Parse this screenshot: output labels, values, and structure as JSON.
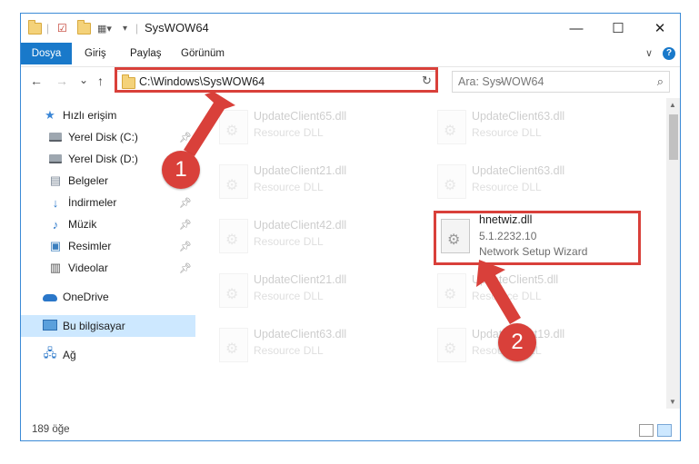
{
  "window": {
    "title": "SysWOW64",
    "controls": {
      "minimize": "—",
      "maximize": "☐",
      "close": "✕"
    }
  },
  "ribbon": {
    "tabs": [
      "Dosya",
      "Giriş",
      "Paylaş",
      "Görünüm"
    ],
    "help": "?",
    "expand": "∨"
  },
  "nav": {
    "back": "←",
    "forward": "→",
    "recent": "⌄",
    "up": "↑",
    "address": "C:\\Windows\\SysWOW64",
    "refresh": "↻",
    "dropdown": "⌄",
    "search_placeholder": "Ara: SysWOW64",
    "search_icon": "⌕"
  },
  "sidebar": {
    "items": [
      {
        "label": "Hızlı erişim",
        "icon": "star-icon",
        "pinned": false
      },
      {
        "label": "Yerel Disk (C:)",
        "icon": "drive-icon",
        "pinned": true
      },
      {
        "label": "Yerel Disk (D:)",
        "icon": "drive-icon",
        "pinned": true
      },
      {
        "label": "Belgeler",
        "icon": "documents-icon",
        "pinned": true
      },
      {
        "label": "İndirmeler",
        "icon": "download-icon",
        "pinned": true
      },
      {
        "label": "Müzik",
        "icon": "music-icon",
        "pinned": true
      },
      {
        "label": "Resimler",
        "icon": "pictures-icon",
        "pinned": true
      },
      {
        "label": "Videolar",
        "icon": "video-icon",
        "pinned": true
      },
      {
        "label": "OneDrive",
        "icon": "onedrive-icon",
        "pinned": false
      },
      {
        "label": "Bu bilgisayar",
        "icon": "computer-icon",
        "pinned": false
      },
      {
        "label": "Ağ",
        "icon": "network-icon",
        "pinned": false
      }
    ]
  },
  "files": [
    {
      "name": "UpdateClient65.dll",
      "sub": "Resource DLL"
    },
    {
      "name": "UpdateClient63.dll",
      "sub": "Resource DLL"
    },
    {
      "name": "UpdateClient21.dll",
      "sub": "Resource DLL"
    },
    {
      "name": "UpdateClient63.dll",
      "sub": "Resource DLL"
    },
    {
      "name": "UpdateClient42.dll",
      "sub": "Resource DLL"
    },
    {
      "name": "UpdateClient21.dll",
      "sub": "Resource DLL"
    },
    {
      "name": "UpdateClient5.dll",
      "sub": "Resource DLL"
    },
    {
      "name": "UpdateClient63.dll",
      "sub": "Resource DLL"
    },
    {
      "name": "UpdateClient19.dll",
      "sub": "Resource DLL"
    }
  ],
  "highlighted_file": {
    "name": "hnetwiz.dll",
    "version": "5.1.2232.10",
    "description": "Network Setup Wizard"
  },
  "status": {
    "count": "189 öğe"
  },
  "annotations": {
    "badge1": "1",
    "badge2": "2",
    "color": "#d9403a"
  }
}
